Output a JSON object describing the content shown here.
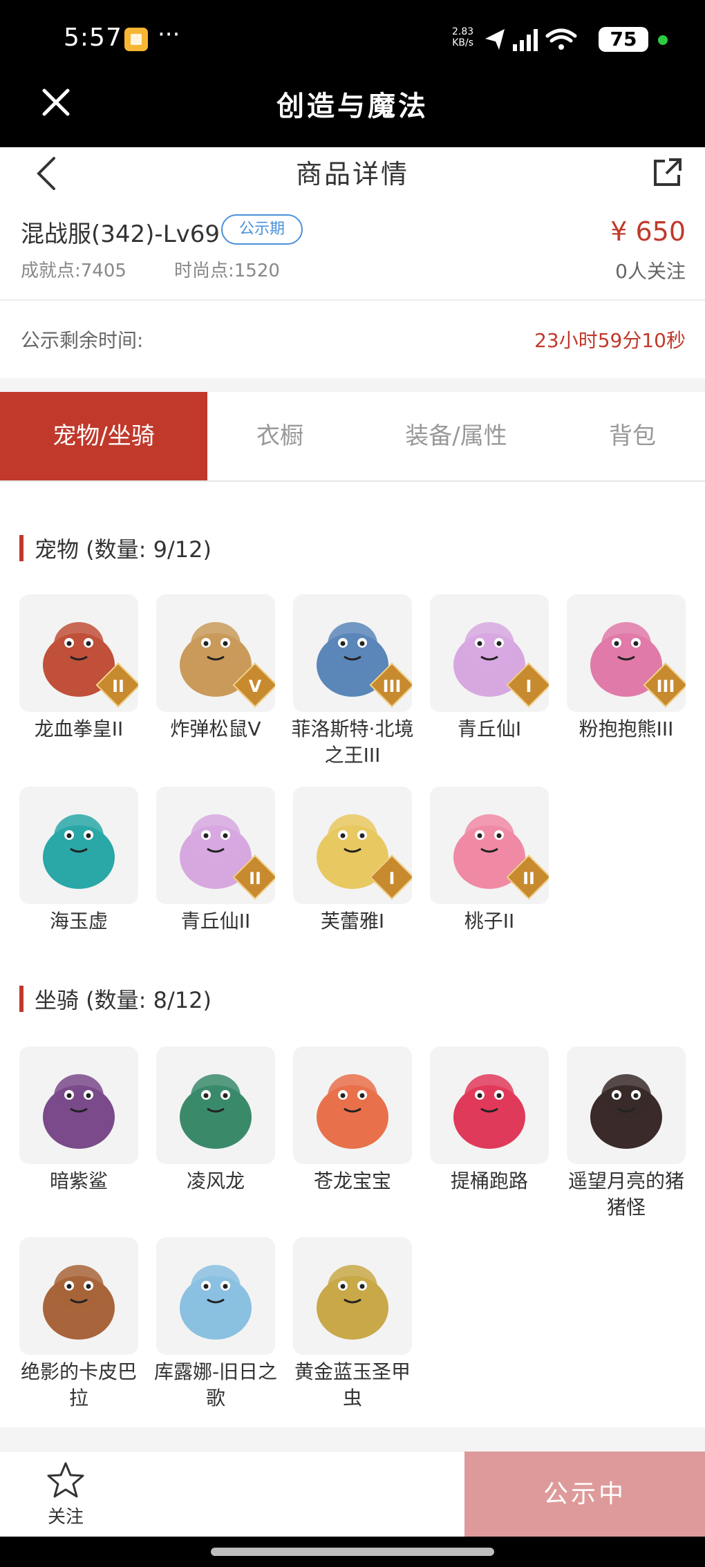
{
  "status_bar": {
    "time": "5:57",
    "more": "···",
    "network_speed": "2.83\nKB/s",
    "battery": "75",
    "icons": [
      "app-notification-icon",
      "location-icon",
      "signal-icon",
      "wifi-icon",
      "battery-icon"
    ]
  },
  "app_bar": {
    "title": "创造与魔法",
    "close_icon": "close-icon"
  },
  "nav": {
    "title": "商品详情",
    "back_icon": "chevron-left-icon",
    "share_icon": "share-icon"
  },
  "item": {
    "name": "混战服(342)-Lv69",
    "badge": "公示期",
    "achievement": "成就点:7405",
    "fashion": "时尚点:1520",
    "price": "¥ 650",
    "followers": "0人关注"
  },
  "remaining": {
    "label": "公示剩余时间:",
    "value": "23小时59分10秒"
  },
  "tabs": [
    {
      "label": "宠物/坐骑",
      "active": true
    },
    {
      "label": "衣橱",
      "active": false
    },
    {
      "label": "装备/属性",
      "active": false
    },
    {
      "label": "背包",
      "active": false
    }
  ],
  "pets_section": {
    "title": "宠物 (数量: 9/12)",
    "items": [
      {
        "name": "龙血拳皇II",
        "rank": "II",
        "color": "#c0503a"
      },
      {
        "name": "炸弹松鼠V",
        "rank": "V",
        "color": "#c99a5a"
      },
      {
        "name": "菲洛斯特·北境之王III",
        "rank": "III",
        "color": "#5a86b8"
      },
      {
        "name": "青丘仙I",
        "rank": "I",
        "color": "#d7a8e0"
      },
      {
        "name": "粉抱抱熊III",
        "rank": "III",
        "color": "#e07aa8"
      },
      {
        "name": "海玉虚",
        "rank": "",
        "color": "#2aa7a7"
      },
      {
        "name": "青丘仙II",
        "rank": "II",
        "color": "#d7a8e0"
      },
      {
        "name": "芙蕾雅I",
        "rank": "I",
        "color": "#e8c860"
      },
      {
        "name": "桃子II",
        "rank": "II",
        "color": "#f08aa4"
      }
    ]
  },
  "mounts_section": {
    "title": "坐骑 (数量: 8/12)",
    "items": [
      {
        "name": "暗紫鲨",
        "color": "#7a4a8a"
      },
      {
        "name": "凌风龙",
        "color": "#3a8a6a"
      },
      {
        "name": "苍龙宝宝",
        "color": "#e8704a"
      },
      {
        "name": "提桶跑路",
        "color": "#e03a5a"
      },
      {
        "name": "遥望月亮的猪猪怪",
        "color": "#3a2a2a"
      },
      {
        "name": "绝影的卡皮巴拉",
        "color": "#a8643a"
      },
      {
        "name": "库露娜-旧日之歌",
        "color": "#8ac0e0"
      },
      {
        "name": "黄金蓝玉圣甲虫",
        "color": "#c8a848"
      }
    ]
  },
  "bottom_bar": {
    "follow_label": "关注",
    "follow_icon": "star-icon",
    "status_button": "公示中"
  },
  "colors": {
    "accent": "#c0392b",
    "badge_blue": "#4a90d9",
    "status_button_bg": "#de9a9a"
  }
}
